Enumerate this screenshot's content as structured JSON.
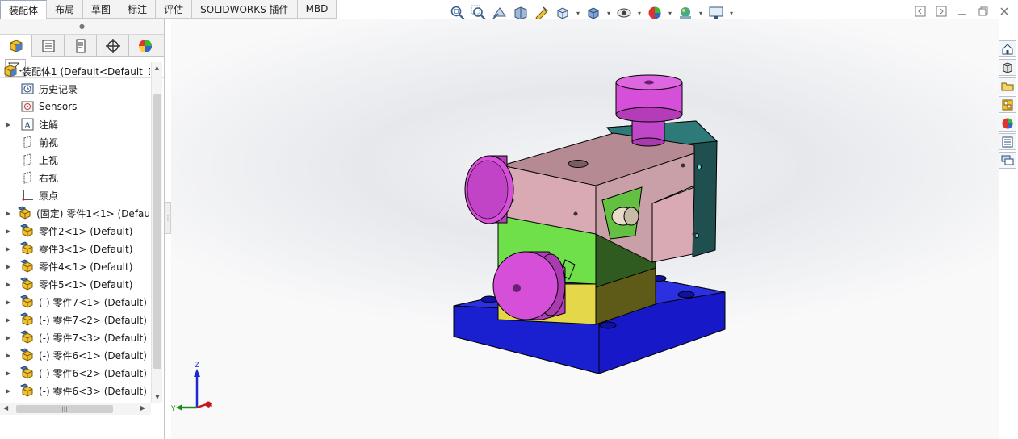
{
  "tabs": [
    {
      "label": "装配体",
      "active": true
    },
    {
      "label": "布局",
      "active": false
    },
    {
      "label": "草图",
      "active": false
    },
    {
      "label": "标注",
      "active": false
    },
    {
      "label": "评估",
      "active": false
    },
    {
      "label": "SOLIDWORKS 插件",
      "active": false
    },
    {
      "label": "MBD",
      "active": false
    }
  ],
  "hud_toolbar": [
    "zoom-to-fit-icon",
    "zoom-to-area-icon",
    "previous-view-icon",
    "section-view-icon",
    "dynamic-annotation-icon",
    "view-orientation-icon",
    "display-style-icon",
    "hide-show-items-icon",
    "edit-appearance-icon",
    "apply-scene-icon",
    "view-settings-icon"
  ],
  "feature_tree": {
    "root": "装配体1  (Default<Default_D",
    "items": [
      {
        "label": "历史记录",
        "icon": "history-icon",
        "expandable": false
      },
      {
        "label": "Sensors",
        "icon": "sensors-icon",
        "expandable": false
      },
      {
        "label": "注解",
        "icon": "annotations-icon",
        "expandable": true
      },
      {
        "label": "前视",
        "icon": "plane-icon",
        "expandable": false
      },
      {
        "label": "上视",
        "icon": "plane-icon",
        "expandable": false
      },
      {
        "label": "右视",
        "icon": "plane-icon",
        "expandable": false
      },
      {
        "label": "原点",
        "icon": "origin-icon",
        "expandable": false
      },
      {
        "label": "(固定) 零件1<1> (Defau",
        "icon": "part-icon",
        "expandable": true
      },
      {
        "label": "零件2<1> (Default)",
        "icon": "part-icon",
        "expandable": true
      },
      {
        "label": "零件3<1> (Default)",
        "icon": "part-icon",
        "expandable": true
      },
      {
        "label": "零件4<1> (Default)",
        "icon": "part-icon",
        "expandable": true
      },
      {
        "label": "零件5<1> (Default)",
        "icon": "part-icon",
        "expandable": true
      },
      {
        "label": "(-) 零件7<1> (Default)",
        "icon": "part-icon",
        "expandable": true
      },
      {
        "label": "(-) 零件7<2> (Default)",
        "icon": "part-icon",
        "expandable": true
      },
      {
        "label": "(-) 零件7<3> (Default)",
        "icon": "part-icon",
        "expandable": true
      },
      {
        "label": "(-) 零件6<1> (Default)",
        "icon": "part-icon",
        "expandable": true
      },
      {
        "label": "(-) 零件6<2> (Default)",
        "icon": "part-icon",
        "expandable": true
      },
      {
        "label": "(-) 零件6<3> (Default)",
        "icon": "part-icon",
        "expandable": true
      }
    ]
  },
  "triad": {
    "x_label": "X",
    "y_label": "Y",
    "z_label": "Z"
  },
  "colors": {
    "base": "#1a1fd0",
    "body_pink": "#d9a9b4",
    "body_green": "#6fe04a",
    "body_yellow": "#e4d84a",
    "knob_magenta": "#d64fd8",
    "side_teal": "#1f4f4f"
  },
  "task_pane": [
    "home-icon",
    "design-library-icon",
    "file-explorer-icon",
    "view-palette-icon",
    "appearances-icon",
    "custom-properties-icon",
    "forum-icon"
  ]
}
